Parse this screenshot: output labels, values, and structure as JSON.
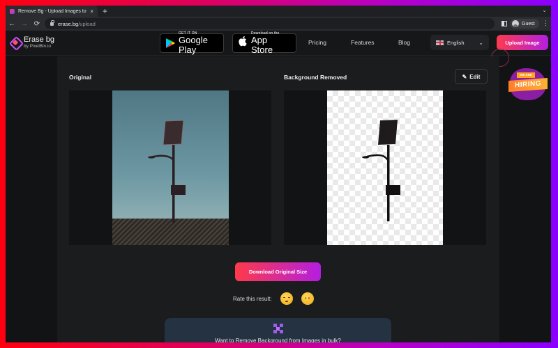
{
  "browser": {
    "tab": {
      "title": "Remove Bg - Upload Images to",
      "close_icon": "×"
    },
    "new_tab_icon": "+",
    "tab_menu_icon": "⌄",
    "nav": {
      "back_icon": "←",
      "forward_icon": "→",
      "reload_icon": "⟳"
    },
    "url": {
      "domain": "erase.bg",
      "path": "/upload"
    },
    "profile": {
      "label": "Guest"
    },
    "menu_icon": "⋮"
  },
  "site": {
    "logo": {
      "name": "Erase bg",
      "byline": "by PixelBin.io"
    },
    "google_play": {
      "small": "GET IT ON",
      "big": "Google Play"
    },
    "app_store": {
      "small": "Download on the",
      "big": "App Store",
      "icon": ""
    },
    "nav_links": [
      "Pricing",
      "Features",
      "Blog"
    ],
    "language": {
      "selected": "English",
      "chevron": "⌄"
    },
    "upload_button": "Upload Image",
    "hiring_badge": {
      "small": "WE ARE",
      "big": "HIRING"
    }
  },
  "main": {
    "original_label": "Original",
    "removed_label": "Background Removed",
    "edit_button": {
      "icon": "✎",
      "label": "Edit"
    },
    "download_button": "Download Original Size",
    "rate": {
      "label": "Rate this result:",
      "options": [
        "sleepy-face",
        "face-without-mouth"
      ]
    },
    "bulk": {
      "text": "Want to Remove Background from Images in bulk?"
    }
  },
  "colors": {
    "accent_gradient_start": "#ff3a4f",
    "accent_gradient_end": "#b41ee0",
    "page_background": "#1b1c1e"
  }
}
